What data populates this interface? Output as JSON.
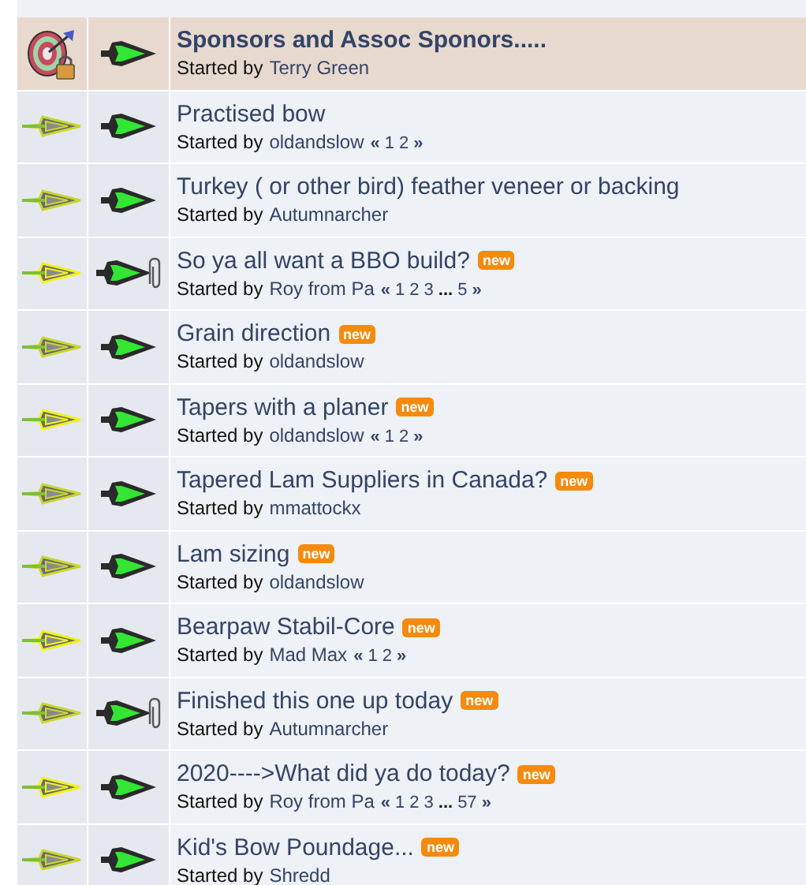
{
  "topics": [
    {
      "kind": "sticky_locked",
      "attachment": false,
      "title": "Sponsors and Assoc Sponors.....",
      "sticky": true,
      "is_new": false,
      "started_label": "Started by",
      "starter": "Terry Green"
    },
    {
      "kind": "normal",
      "attachment": false,
      "title": "Practised bow",
      "sticky": false,
      "is_new": false,
      "started_label": "Started by",
      "starter": "oldandslow",
      "pages": [
        {
          "kind": "mark",
          "text": "«"
        },
        {
          "kind": "link",
          "text": "1"
        },
        {
          "kind": "link",
          "text": "2"
        },
        {
          "kind": "mark",
          "text": "»"
        }
      ]
    },
    {
      "kind": "normal",
      "attachment": false,
      "title": "Turkey ( or other bird) feather veneer or backing",
      "sticky": false,
      "is_new": false,
      "started_label": "Started by",
      "starter": "Autumnarcher"
    },
    {
      "kind": "hot",
      "attachment": true,
      "title": "So ya all want a BBO build?",
      "sticky": false,
      "is_new": true,
      "new_label": "new",
      "started_label": "Started by",
      "starter": "Roy from Pa",
      "pages": [
        {
          "kind": "mark",
          "text": "«"
        },
        {
          "kind": "link",
          "text": "1"
        },
        {
          "kind": "link",
          "text": "2"
        },
        {
          "kind": "link",
          "text": "3"
        },
        {
          "kind": "gap",
          "text": "..."
        },
        {
          "kind": "link",
          "text": "5"
        },
        {
          "kind": "mark",
          "text": "»"
        }
      ]
    },
    {
      "kind": "normal",
      "attachment": false,
      "title": "Grain direction",
      "sticky": false,
      "is_new": true,
      "new_label": "new",
      "started_label": "Started by",
      "starter": "oldandslow"
    },
    {
      "kind": "hot",
      "attachment": false,
      "title": "Tapers with a planer",
      "sticky": false,
      "is_new": true,
      "new_label": "new",
      "started_label": "Started by",
      "starter": "oldandslow",
      "pages": [
        {
          "kind": "mark",
          "text": "«"
        },
        {
          "kind": "link",
          "text": "1"
        },
        {
          "kind": "link",
          "text": "2"
        },
        {
          "kind": "mark",
          "text": "»"
        }
      ]
    },
    {
      "kind": "normal",
      "attachment": false,
      "title": "Tapered Lam Suppliers in Canada?",
      "sticky": false,
      "is_new": true,
      "new_label": "new",
      "started_label": "Started by",
      "starter": "mmattockx"
    },
    {
      "kind": "normal",
      "attachment": false,
      "title": "Lam sizing",
      "sticky": false,
      "is_new": true,
      "new_label": "new",
      "started_label": "Started by",
      "starter": "oldandslow"
    },
    {
      "kind": "hot",
      "attachment": false,
      "title": "Bearpaw Stabil-Core",
      "sticky": false,
      "is_new": true,
      "new_label": "new",
      "started_label": "Started by",
      "starter": "Mad Max",
      "pages": [
        {
          "kind": "mark",
          "text": "«"
        },
        {
          "kind": "link",
          "text": "1"
        },
        {
          "kind": "link",
          "text": "2"
        },
        {
          "kind": "mark",
          "text": "»"
        }
      ]
    },
    {
      "kind": "normal",
      "attachment": true,
      "title": "Finished this one up today",
      "sticky": false,
      "is_new": true,
      "new_label": "new",
      "started_label": "Started by",
      "starter": "Autumnarcher"
    },
    {
      "kind": "hot",
      "attachment": false,
      "title": "2020---->What did ya do today?",
      "sticky": false,
      "is_new": true,
      "new_label": "new",
      "started_label": "Started by",
      "starter": "Roy from Pa",
      "pages": [
        {
          "kind": "mark",
          "text": "«"
        },
        {
          "kind": "link",
          "text": "1"
        },
        {
          "kind": "link",
          "text": "2"
        },
        {
          "kind": "link",
          "text": "3"
        },
        {
          "kind": "gap",
          "text": "..."
        },
        {
          "kind": "link",
          "text": "57"
        },
        {
          "kind": "mark",
          "text": "»"
        }
      ]
    },
    {
      "kind": "normal",
      "attachment": false,
      "title": "Kid's Bow Poundage...",
      "sticky": false,
      "is_new": true,
      "new_label": "new",
      "started_label": "Started by",
      "starter": "Shredd"
    }
  ]
}
